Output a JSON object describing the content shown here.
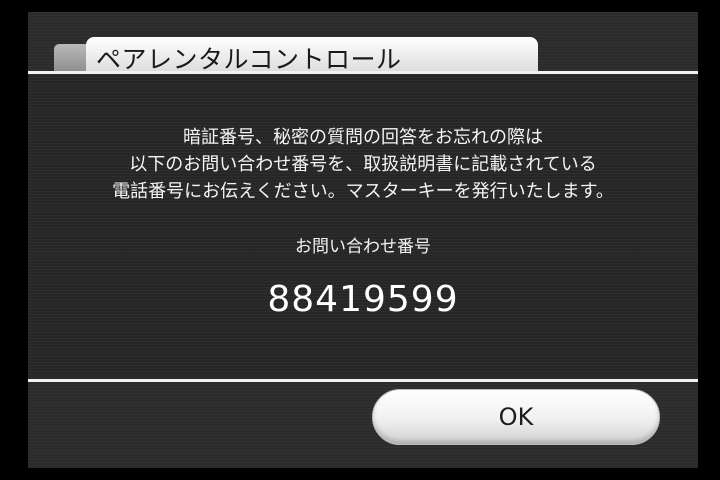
{
  "window": {
    "title": "ペアレンタルコントロール"
  },
  "message": {
    "lines": [
      "暗証番号、秘密の質問の回答をお忘れの際は",
      "以下のお問い合わせ番号を、取扱説明書に記載されている",
      "電話番号にお伝えください。マスターキーを発行いたします。"
    ]
  },
  "inquiry": {
    "label": "お問い合わせ番号",
    "number": "88419599"
  },
  "buttons": {
    "ok_label": "OK"
  }
}
